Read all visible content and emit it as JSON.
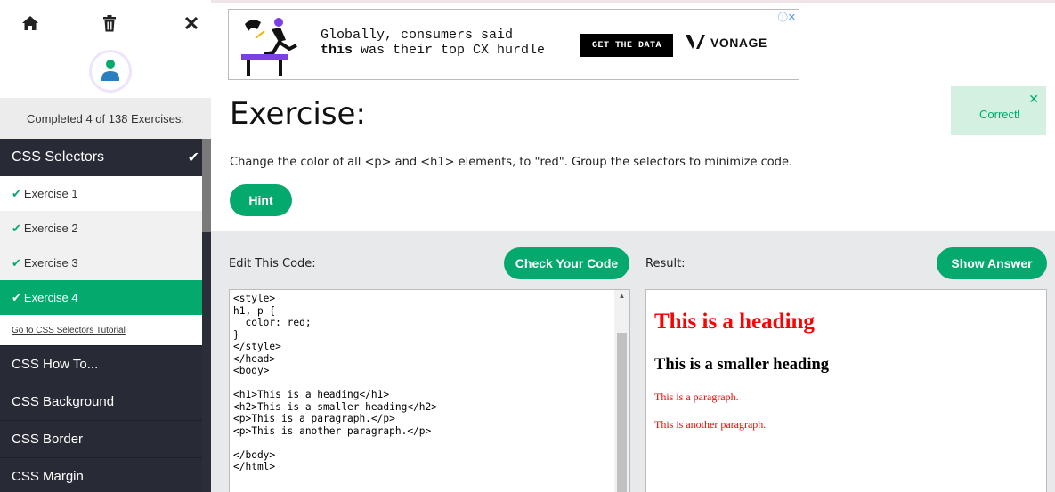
{
  "sidebar": {
    "icons": {
      "home": "home-icon",
      "trash": "trash-icon",
      "close": "close-icon"
    },
    "progress_text": "Completed 4 of 138 Exercises:",
    "section": {
      "label": "CSS Selectors",
      "check": "✔"
    },
    "exercises": [
      {
        "label": "Exercise 1"
      },
      {
        "label": "Exercise 2"
      },
      {
        "label": "Exercise 3"
      },
      {
        "label": "Exercise 4"
      }
    ],
    "tutorial_link": "Go to CSS Selectors Tutorial",
    "topics": [
      "CSS How To...",
      "CSS Background",
      "CSS Border",
      "CSS Margin"
    ]
  },
  "ad": {
    "line1": "Globally, consumers said",
    "line2_bold": "this",
    "line2_rest": " was their top CX hurdle",
    "button": "GET THE DATA",
    "brand": "VONAGE",
    "close": "ⓘ✕"
  },
  "exercise": {
    "title": "Exercise:",
    "instruction": "Change the color of all <p> and <h1> elements, to \"red\". Group the selectors to minimize code.",
    "hint_label": "Hint",
    "toast": {
      "message": "Correct!",
      "close": "✕"
    }
  },
  "editor": {
    "label": "Edit This Code:",
    "check_button": "Check Your Code",
    "code": "<style>\nh1, p {\n  color: red;\n}\n</style>\n</head>\n<body>\n\n<h1>This is a heading</h1>\n<h2>This is a smaller heading</h2>\n<p>This is a paragraph.</p>\n<p>This is another paragraph.</p>\n\n</body>\n</html>"
  },
  "result": {
    "label": "Result:",
    "show_button": "Show Answer",
    "h1": "This is a heading",
    "h2": "This is a smaller heading",
    "p1": "This is a paragraph.",
    "p2": "This is another paragraph."
  },
  "colors": {
    "accent": "#04aa6d",
    "sidebar_dark": "#282a35",
    "result_red": "#ff0000"
  }
}
